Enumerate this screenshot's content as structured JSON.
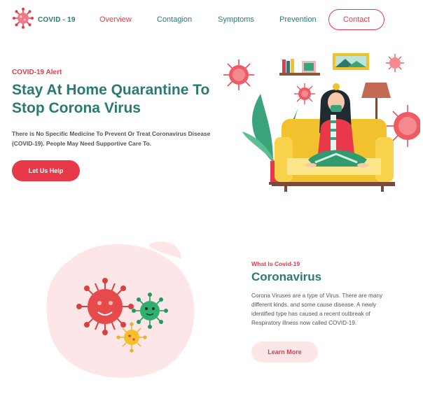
{
  "brand": {
    "name": "COVID - 19",
    "icon": "virus-icon"
  },
  "nav": {
    "items": [
      {
        "label": "Overview",
        "active": true
      },
      {
        "label": "Contagion",
        "active": false
      },
      {
        "label": "Symptoms",
        "active": false
      },
      {
        "label": "Prevention",
        "active": false
      }
    ],
    "contact_label": "Contact"
  },
  "hero": {
    "alert": "COVID-19 Alert",
    "title": "Stay At Home Quarantine To Stop Corona Virus",
    "description": "There is No Specific Medicine To Prevent Or Treat Coronavirus Disease (COVID-19). People May Need Supportive Care To.",
    "button_label": "Let Us Help"
  },
  "about": {
    "eyebrow": "What Is Covid-19",
    "title": "Coronavirus",
    "body": "Corona Viruses are a type of Virus. There are many different kinds, and some cause disease. A newly identified type has caused a recent outbreak of Respiratory illness now called COVID-19.",
    "button_label": "Learn More"
  },
  "colors": {
    "accent": "#e8394a",
    "primary": "#2b7a6f",
    "soft_pink": "#fde6e8"
  }
}
